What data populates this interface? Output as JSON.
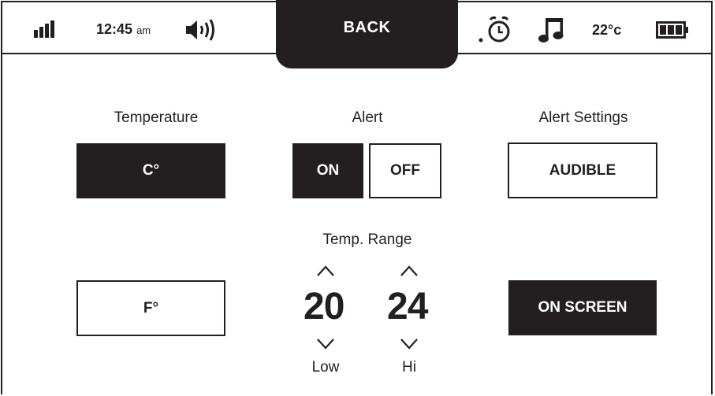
{
  "status_bar": {
    "time": "12:45",
    "time_suffix": "am",
    "temperature": "22°c",
    "back_label": "BACK",
    "icons": [
      "signal-icon",
      "speaker-icon",
      "alarm-clock-icon",
      "music-note-icon",
      "battery-icon"
    ]
  },
  "temperature": {
    "title": "Temperature",
    "celsius_label": "C°",
    "fahrenheit_label": "F°",
    "selected": "C°"
  },
  "alert": {
    "title": "Alert",
    "on_label": "ON",
    "off_label": "OFF",
    "selected": "ON"
  },
  "alert_settings": {
    "title": "Alert Settings",
    "audible_label": "AUDIBLE",
    "on_screen_label": "ON SCREEN",
    "selected": "ON SCREEN"
  },
  "temp_range": {
    "title": "Temp. Range",
    "low_value": "20",
    "low_label": "Low",
    "hi_value": "24",
    "hi_label": "Hi"
  },
  "colors": {
    "foreground": "#231f20",
    "background": "#ffffff"
  }
}
